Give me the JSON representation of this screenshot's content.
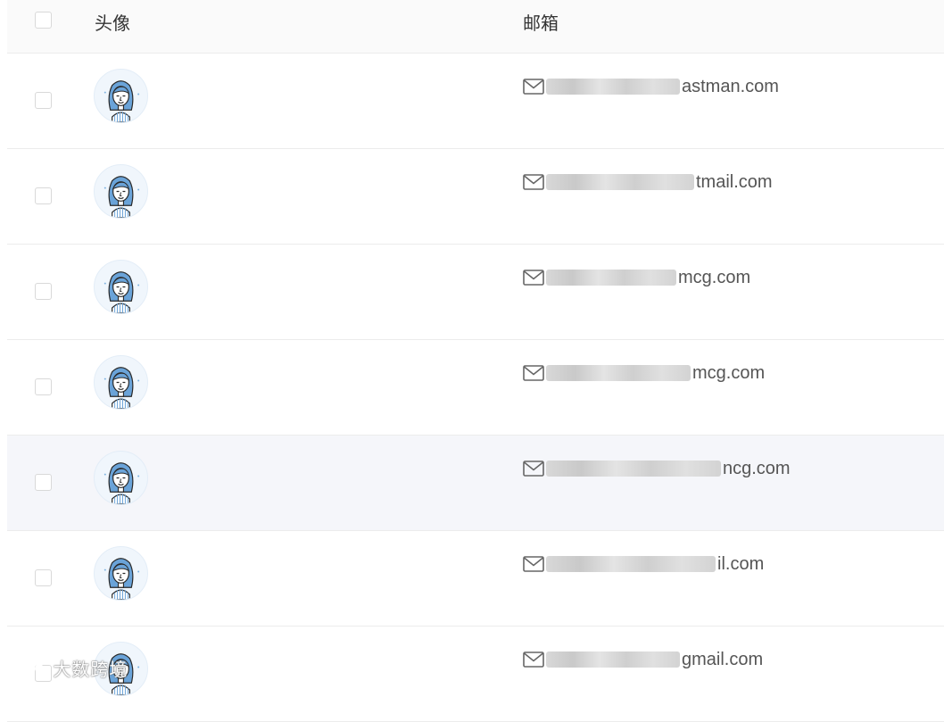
{
  "header": {
    "avatar_label": "头像",
    "email_label": "邮箱"
  },
  "rows": [
    {
      "email_suffix": "astman.com",
      "highlighted": false
    },
    {
      "email_suffix": "tmail.com",
      "highlighted": false
    },
    {
      "email_suffix": "mcg.com",
      "highlighted": false
    },
    {
      "email_suffix": "mcg.com",
      "highlighted": false
    },
    {
      "email_suffix": "ncg.com",
      "highlighted": true
    },
    {
      "email_suffix": "il.com",
      "highlighted": false
    },
    {
      "email_suffix": "gmail.com",
      "highlighted": false
    }
  ],
  "icons": {
    "row_icon": "mail-icon",
    "avatar_icon": "user-avatar-icon"
  },
  "watermark": "大数跨境",
  "colors": {
    "header_bg": "#fafafa",
    "row_highlight_bg": "#f5f6fa",
    "border": "#ececec",
    "avatar_hair": "#6aa3d8"
  }
}
